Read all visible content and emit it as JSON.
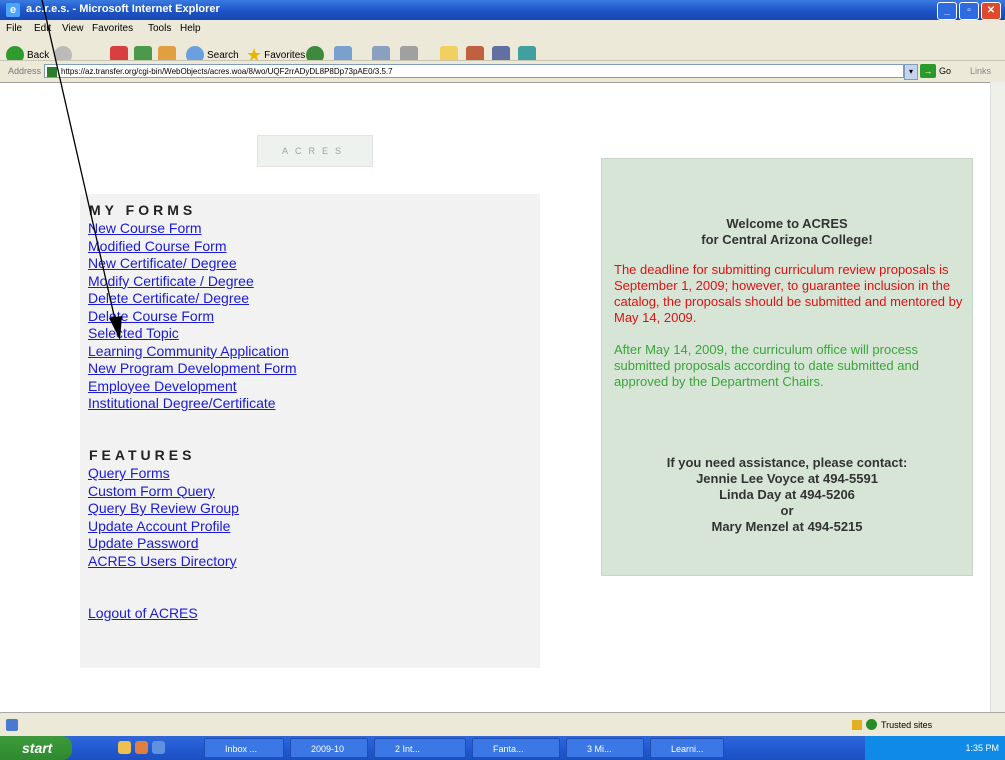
{
  "window": {
    "title": "a.c.r.e.s. - Microsoft Internet Explorer"
  },
  "menu": [
    "File",
    "Edit",
    "View",
    "Favorites",
    "Tools",
    "Help"
  ],
  "toolbar": {
    "back": "Back",
    "search": "Search",
    "favorites": "Favorites"
  },
  "address": {
    "label": "Address",
    "url": "https://az.transfer.org/cgi-bin/WebObjects/acres.woa/8/wo/UQF2rrADyDL8P8Dp73pAE0/3.5.7",
    "go": "Go",
    "links": "Links"
  },
  "logo": "ACRES",
  "my_forms": {
    "heading": "MY FORMS",
    "links": [
      "New Course Form",
      "Modified Course Form",
      "New Certificate/ Degree",
      "Modify Certificate / Degree",
      "Delete Certificate/ Degree",
      "Delete Course Form",
      "Selected Topic",
      "Learning Community Application",
      "New Program Development Form",
      "Employee Development",
      "Institutional Degree/Certificate"
    ]
  },
  "features": {
    "heading": "FEATURES",
    "links": [
      "Query Forms",
      "Custom Form Query",
      "Query By Review Group",
      "Update Account Profile",
      "Update Password",
      "ACRES Users Directory"
    ]
  },
  "logout": "Logout of ACRES",
  "welcome": {
    "line1": "Welcome to ACRES",
    "line2": "for Central Arizona College!",
    "deadline": "The deadline for submitting curriculum review proposals is September 1, 2009; however, to guarantee inclusion in the catalog, the proposals should be submitted and mentored by May 14, 2009.",
    "after": "After May 14, 2009, the curriculum office will process submitted proposals according to date submitted and approved by the Department Chairs.",
    "contact_intro": "If you need assistance, please contact:",
    "contact1": "Jennie Lee Voyce at 494-5591",
    "contact2": "Linda Day at 494-5206",
    "or": "or",
    "contact3": "Mary Menzel at 494-5215"
  },
  "status": {
    "zone": "Trusted sites"
  },
  "taskbar": {
    "start": "start",
    "buttons": [
      "Inbox ...",
      "2009-10",
      "2 Int...",
      "Fanta...",
      "3 Mi...",
      "Learni..."
    ],
    "clock": "1:35 PM"
  },
  "colors": {
    "link": "#1a1ad8",
    "panel": "#d7e5d7",
    "red_text": "#e01010",
    "green_text": "#3aa53a"
  }
}
